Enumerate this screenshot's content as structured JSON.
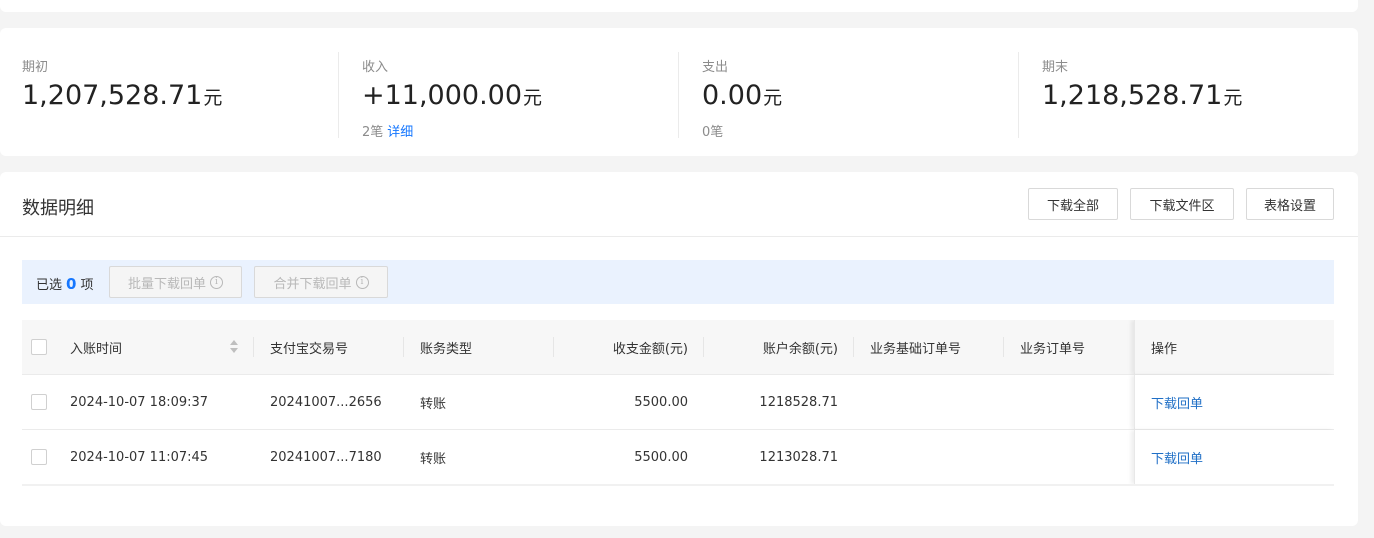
{
  "summary": [
    {
      "label": "期初",
      "amount": "1,207,528.71",
      "unit": "元",
      "sub": ""
    },
    {
      "label": "收入",
      "amount": "+11,000.00",
      "unit": "元",
      "sub": "2笔",
      "link": "详细"
    },
    {
      "label": "支出",
      "amount": "0.00",
      "unit": "元",
      "sub": "0笔"
    },
    {
      "label": "期末",
      "amount": "1,218,528.71",
      "unit": "元",
      "sub": ""
    }
  ],
  "detail": {
    "title": "数据明细",
    "buttons": {
      "download_all": "下载全部",
      "download_files": "下载文件区",
      "table_settings": "表格设置"
    },
    "batch": {
      "selected_prefix": "已选",
      "selected_count": "0",
      "selected_suffix": "项",
      "batch_download": "批量下载回单",
      "merge_download": "合并下载回单"
    }
  },
  "table": {
    "columns": [
      "入账时间",
      "支付宝交易号",
      "账务类型",
      "收支金额(元)",
      "账户余额(元)",
      "业务基础订单号",
      "业务订单号",
      "操作"
    ],
    "rows": [
      {
        "time": "2024-10-07 18:09:37",
        "trade_no": "20241007...2656",
        "type": "转账",
        "amount": "5500.00",
        "balance": "1218528.71",
        "base_order": "",
        "order": "",
        "action": "下载回单"
      },
      {
        "time": "2024-10-07 11:07:45",
        "trade_no": "20241007...7180",
        "type": "转账",
        "amount": "5500.00",
        "balance": "1213028.71",
        "base_order": "",
        "order": "",
        "action": "下载回单"
      }
    ]
  },
  "colors": {
    "link": "#1677ff",
    "batch_bar": "#eaf2fe",
    "background": "#f4f4f4"
  },
  "icons": {
    "info": "info-circle-icon",
    "sort": "sort-icon",
    "scroll_left": "scroll-left-arrow-icon",
    "scroll_right": "scroll-right-arrow-icon"
  }
}
